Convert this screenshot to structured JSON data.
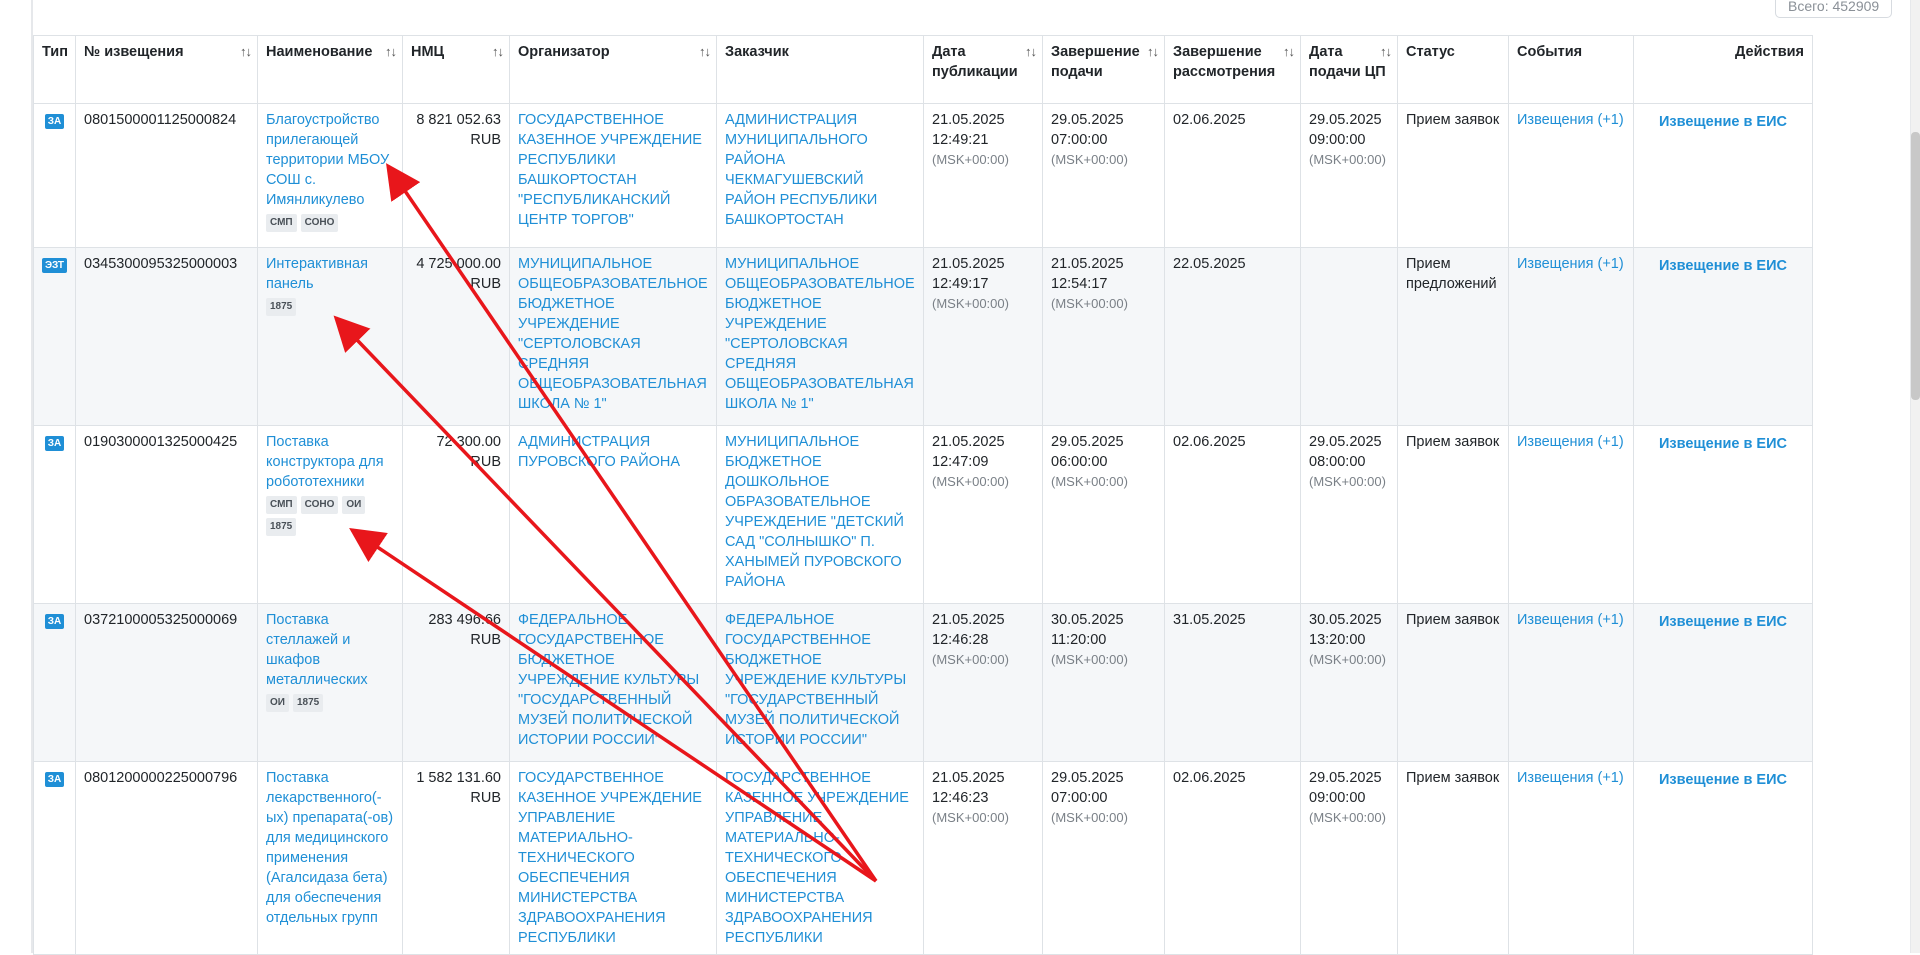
{
  "header": {
    "total": "Всего: 452909"
  },
  "columns": [
    {
      "label": "Тип",
      "sort": false
    },
    {
      "label": "№ извещения",
      "sort": true
    },
    {
      "label": "Наименование",
      "sort": true
    },
    {
      "label": "НМЦ",
      "sort": true
    },
    {
      "label": "Организатор",
      "sort": true
    },
    {
      "label": "Заказчик",
      "sort": false
    },
    {
      "label": "Дата публикации",
      "sort": true
    },
    {
      "label": "Завершение подачи",
      "sort": true
    },
    {
      "label": "Завершение рассмотрения",
      "sort": true
    },
    {
      "label": "Дата подачи ЦП",
      "sort": true
    },
    {
      "label": "Статус",
      "sort": false
    },
    {
      "label": "События",
      "sort": false
    },
    {
      "label": "Действия",
      "sort": false
    }
  ],
  "rows": [
    {
      "type": "ЗА",
      "number": "0801500001125000824",
      "name": "Благоустройство прилегающей территории МБОУ СОШ с. Имянликулево",
      "tags": [
        "СМП",
        "СОНО"
      ],
      "price": "8 821 052.63",
      "currency": "RUB",
      "organizer": "ГОСУДАРСТВЕННОЕ КАЗЕННОЕ УЧРЕЖДЕНИЕ РЕСПУБЛИКИ БАШКОРТОСТАН \"РЕСПУБЛИКАНСКИЙ ЦЕНТР ТОРГОВ\"",
      "customer": "АДМИНИСТРАЦИЯ МУНИЦИПАЛЬНОГО РАЙОНА ЧЕКМАГУШЕВСКИЙ РАЙОН РЕСПУБЛИКИ БАШКОРТОСТАН",
      "pub_date": "21.05.2025",
      "pub_time": "12:49:21",
      "pub_tz": "(MSK+00:00)",
      "end_date": "29.05.2025",
      "end_time": "07:00:00",
      "end_tz": "(MSK+00:00)",
      "review_date": "02.06.2025",
      "cp_date": "29.05.2025",
      "cp_time": "09:00:00",
      "cp_tz": "(MSK+00:00)",
      "status": "Прием заявок",
      "events": "Извещения (+1)",
      "action": "Извещение в ЕИС"
    },
    {
      "type": "ЭЗТ",
      "number": "0345300095325000003",
      "name": "Интерактивная панель",
      "tags": [
        "1875"
      ],
      "price": "4 725 000.00",
      "currency": "RUB",
      "organizer": "МУНИЦИПАЛЬНОЕ ОБЩЕОБРАЗОВАТЕЛЬНОЕ БЮДЖЕТНОЕ УЧРЕЖДЕНИЕ \"СЕРТОЛОВСКАЯ СРЕДНЯЯ ОБЩЕОБРАЗОВАТЕЛЬНАЯ ШКОЛА № 1\"",
      "customer": "МУНИЦИПАЛЬНОЕ ОБЩЕОБРАЗОВАТЕЛЬНОЕ БЮДЖЕТНОЕ УЧРЕЖДЕНИЕ \"СЕРТОЛОВСКАЯ СРЕДНЯЯ ОБЩЕОБРАЗОВАТЕЛЬНАЯ ШКОЛА № 1\"",
      "pub_date": "21.05.2025",
      "pub_time": "12:49:17",
      "pub_tz": "(MSK+00:00)",
      "end_date": "21.05.2025",
      "end_time": "12:54:17",
      "end_tz": "(MSK+00:00)",
      "review_date": "22.05.2025",
      "cp_date": "",
      "cp_time": "",
      "cp_tz": "",
      "status": "Прием предложений",
      "events": "Извещения (+1)",
      "action": "Извещение в ЕИС"
    },
    {
      "type": "ЗА",
      "number": "0190300001325000425",
      "name": "Поставка конструктора для робототехники",
      "tags": [
        "СМП",
        "СОНО",
        "ОИ",
        "1875"
      ],
      "price": "72 300.00",
      "currency": "RUB",
      "organizer": "АДМИНИСТРАЦИЯ ПУРОВСКОГО РАЙОНА",
      "customer": "МУНИЦИПАЛЬНОЕ БЮДЖЕТНОЕ ДОШКОЛЬНОЕ ОБРАЗОВАТЕЛЬНОЕ УЧРЕЖДЕНИЕ \"ДЕТСКИЙ САД \"СОЛНЫШКО\" П. ХАНЫМЕЙ ПУРОВСКОГО РАЙОНА",
      "pub_date": "21.05.2025",
      "pub_time": "12:47:09",
      "pub_tz": "(MSK+00:00)",
      "end_date": "29.05.2025",
      "end_time": "06:00:00",
      "end_tz": "(MSK+00:00)",
      "review_date": "02.06.2025",
      "cp_date": "29.05.2025",
      "cp_time": "08:00:00",
      "cp_tz": "(MSK+00:00)",
      "status": "Прием заявок",
      "events": "Извещения (+1)",
      "action": "Извещение в ЕИС"
    },
    {
      "type": "ЗА",
      "number": "0372100005325000069",
      "name": "Поставка стеллажей и шкафов металлических",
      "tags": [
        "ОИ",
        "1875"
      ],
      "price": "283 496.66",
      "currency": "RUB",
      "organizer": "ФЕДЕРАЛЬНОЕ ГОСУДАРСТВЕННОЕ БЮДЖЕТНОЕ УЧРЕЖДЕНИЕ КУЛЬТУРЫ \"ГОСУДАРСТВЕННЫЙ МУЗЕЙ ПОЛИТИЧЕСКОЙ ИСТОРИИ РОССИИ\"",
      "customer": "ФЕДЕРАЛЬНОЕ ГОСУДАРСТВЕННОЕ БЮДЖЕТНОЕ УЧРЕЖДЕНИЕ КУЛЬТУРЫ \"ГОСУДАРСТВЕННЫЙ МУЗЕЙ ПОЛИТИЧЕСКОЙ ИСТОРИИ РОССИИ\"",
      "pub_date": "21.05.2025",
      "pub_time": "12:46:28",
      "pub_tz": "(MSK+00:00)",
      "end_date": "30.05.2025",
      "end_time": "11:20:00",
      "end_tz": "(MSK+00:00)",
      "review_date": "31.05.2025",
      "cp_date": "30.05.2025",
      "cp_time": "13:20:00",
      "cp_tz": "(MSK+00:00)",
      "status": "Прием заявок",
      "events": "Извещения (+1)",
      "action": "Извещение в ЕИС"
    },
    {
      "type": "ЗА",
      "number": "0801200000225000796",
      "name": "Поставка лекарственного(-ых) препарата(-ов) для медицинского применения (Агалсидаза бета) для обеспечения отдельных групп",
      "tags": [],
      "price": "1 582 131.60",
      "currency": "RUB",
      "organizer": "ГОСУДАРСТВЕННОЕ КАЗЕННОЕ УЧРЕЖДЕНИЕ УПРАВЛЕНИЕ МАТЕРИАЛЬНО-ТЕХНИЧЕСКОГО ОБЕСПЕЧЕНИЯ МИНИСТЕРСТВА ЗДРАВООХРАНЕНИЯ РЕСПУБЛИКИ",
      "customer": "ГОСУДАРСТВЕННОЕ КАЗЕННОЕ УЧРЕЖДЕНИЕ УПРАВЛЕНИЕ МАТЕРИАЛЬНО-ТЕХНИЧЕСКОГО ОБЕСПЕЧЕНИЯ МИНИСТЕРСТВА ЗДРАВООХРАНЕНИЯ РЕСПУБЛИКИ",
      "pub_date": "21.05.2025",
      "pub_time": "12:46:23",
      "pub_tz": "(MSK+00:00)",
      "end_date": "29.05.2025",
      "end_time": "07:00:00",
      "end_tz": "(MSK+00:00)",
      "review_date": "02.06.2025",
      "cp_date": "29.05.2025",
      "cp_time": "09:00:00",
      "cp_tz": "(MSK+00:00)",
      "status": "Прием заявок",
      "events": "Извещения (+1)",
      "action": "Извещение в ЕИС"
    }
  ],
  "colors": {
    "link": "#1f8fd6",
    "annotation_arrow": "#e8161b"
  }
}
